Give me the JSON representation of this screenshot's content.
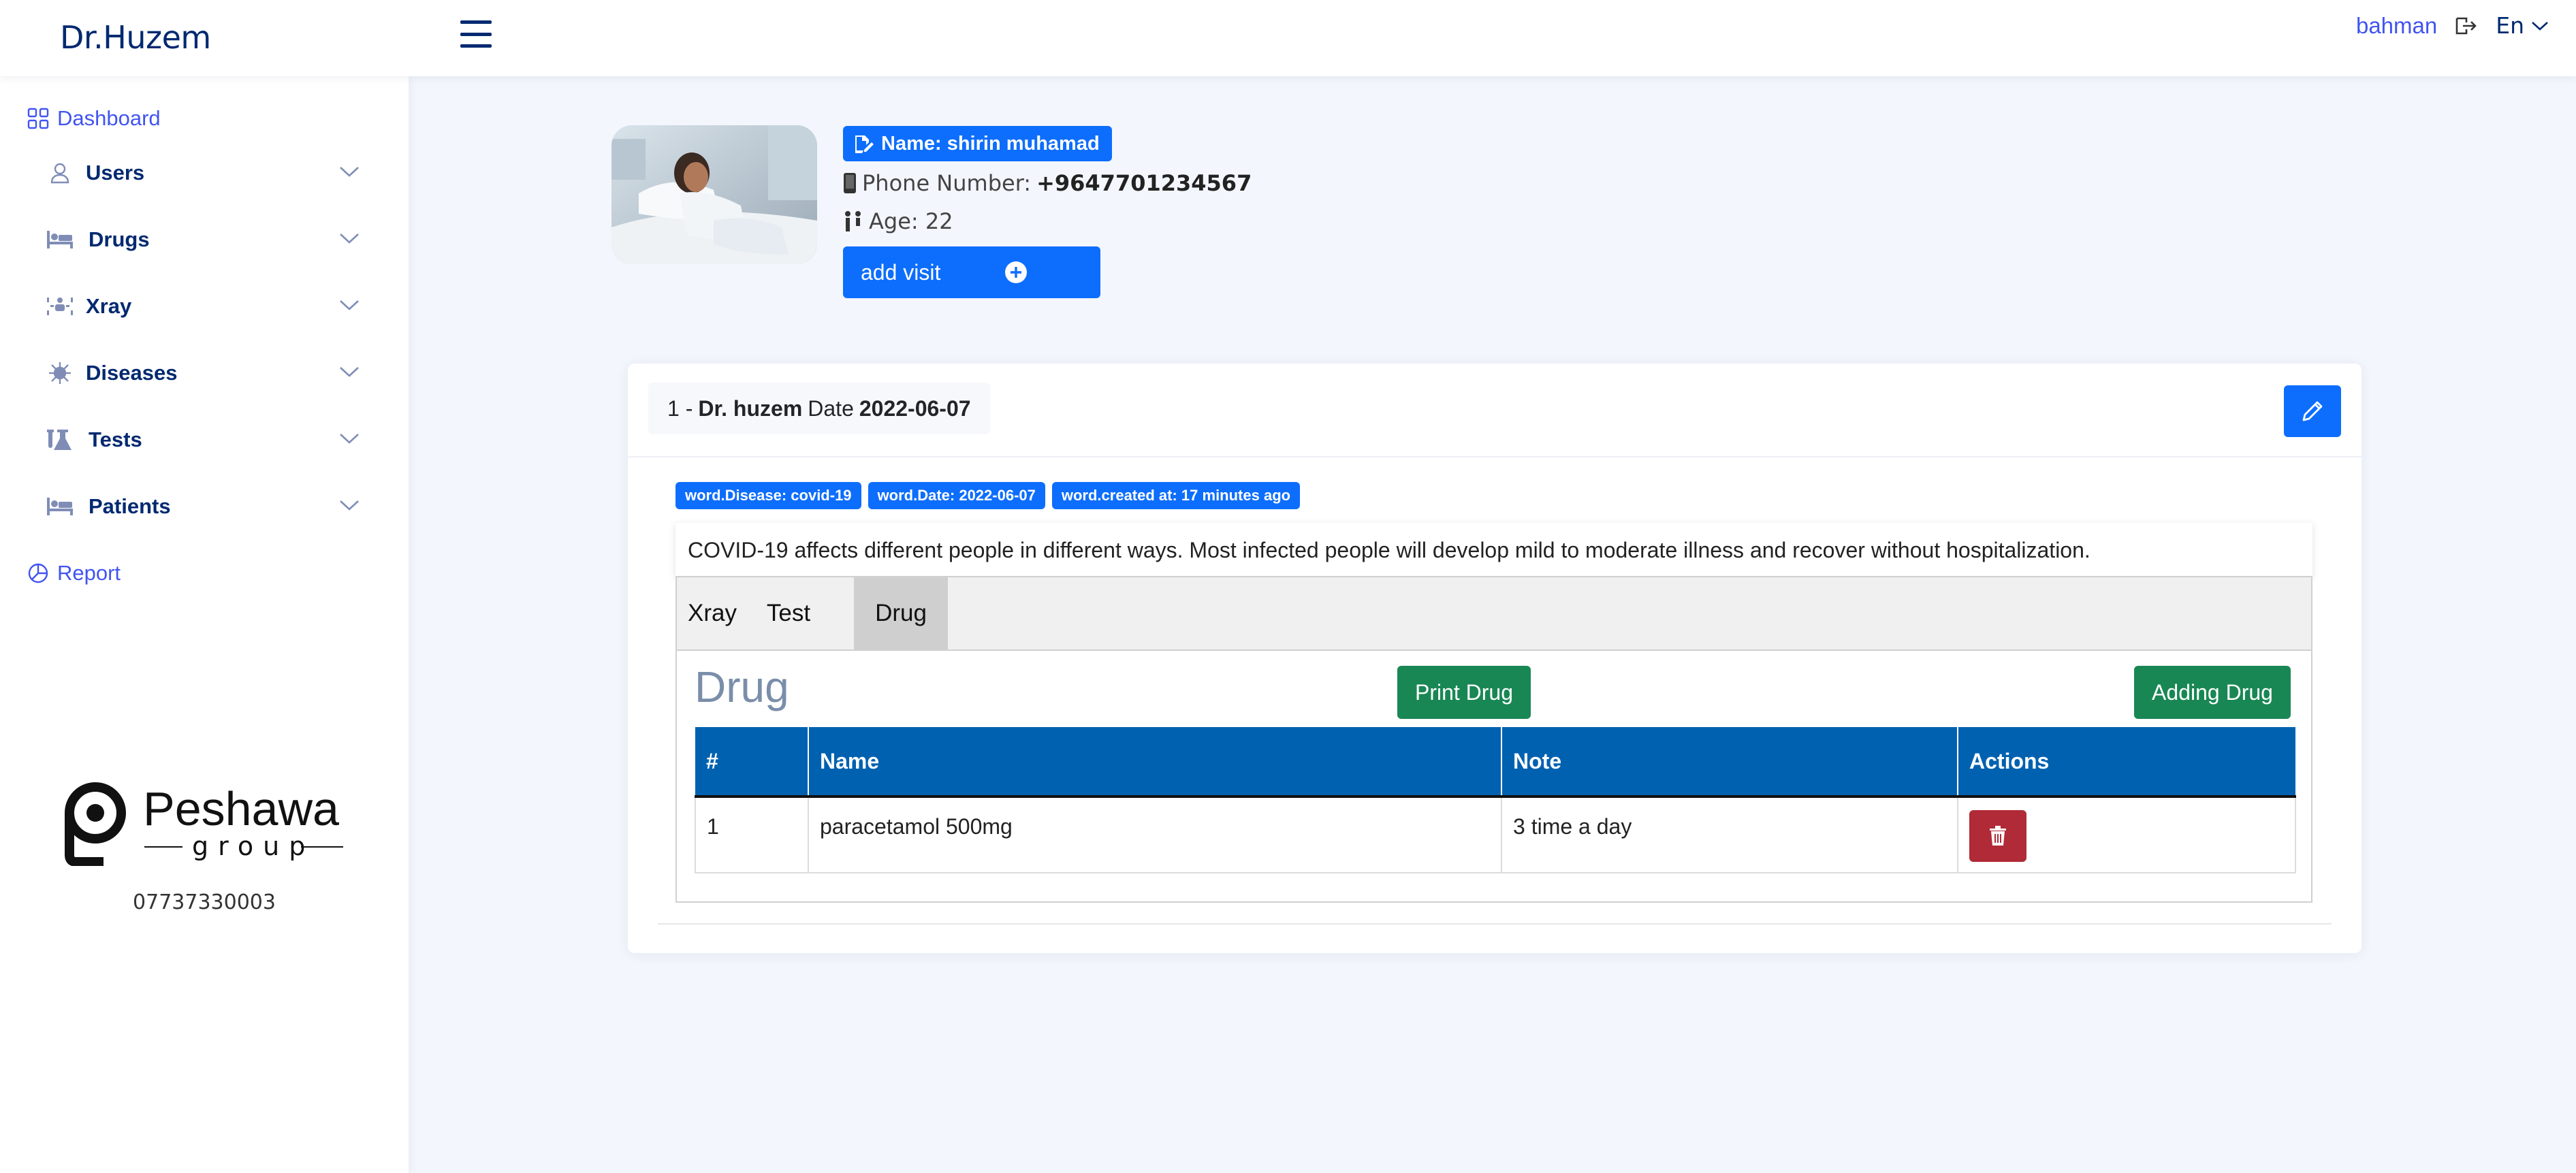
{
  "header": {
    "brand": "Dr.Huzem",
    "username": "bahman",
    "language": "En"
  },
  "sidebar": {
    "dashboard": "Dashboard",
    "items": [
      {
        "label": "Users",
        "icon": "user-icon"
      },
      {
        "label": "Drugs",
        "icon": "bed-icon"
      },
      {
        "label": "Xray",
        "icon": "xray-icon"
      },
      {
        "label": "Diseases",
        "icon": "virus-icon"
      },
      {
        "label": "Tests",
        "icon": "flask-icon"
      },
      {
        "label": "Patients",
        "icon": "bed-icon"
      }
    ],
    "report": "Report",
    "logo": {
      "name": "Peshawa",
      "sub": "group"
    },
    "phone": "07737330003"
  },
  "patient": {
    "name": "Name: shirin muhamad",
    "phone_label": "Phone Number:",
    "phone_value": "+9647701234567",
    "age": "Age: 22",
    "add_visit": "add visit"
  },
  "visit": {
    "index": "1 -",
    "doctor": "Dr. huzem",
    "date_label": "Date",
    "date": "2022-06-07",
    "badges": [
      "word.Disease: covid-19",
      "word.Date: 2022-06-07",
      "word.created at: 17 minutes ago"
    ],
    "description": "COVID-19 affects different people in different ways. Most infected people will develop mild to moderate illness and recover without hospitalization.",
    "tabs": [
      "Xray",
      "Test",
      "Drug"
    ],
    "active_tab": "Drug",
    "section_title": "Drug",
    "print_button": "Print Drug",
    "add_button": "Adding Drug",
    "table": {
      "headers": [
        "#",
        "Name",
        "Note",
        "Actions"
      ],
      "rows": [
        {
          "num": "1",
          "name": "paracetamol 500mg",
          "note": "3 time a day"
        }
      ]
    }
  },
  "colors": {
    "primary": "#0d6efd",
    "navy": "#012970",
    "accent": "#4154f1",
    "success": "#198754",
    "danger": "#b02a37",
    "table_header": "#0061b0",
    "background": "#f3f6fc"
  }
}
